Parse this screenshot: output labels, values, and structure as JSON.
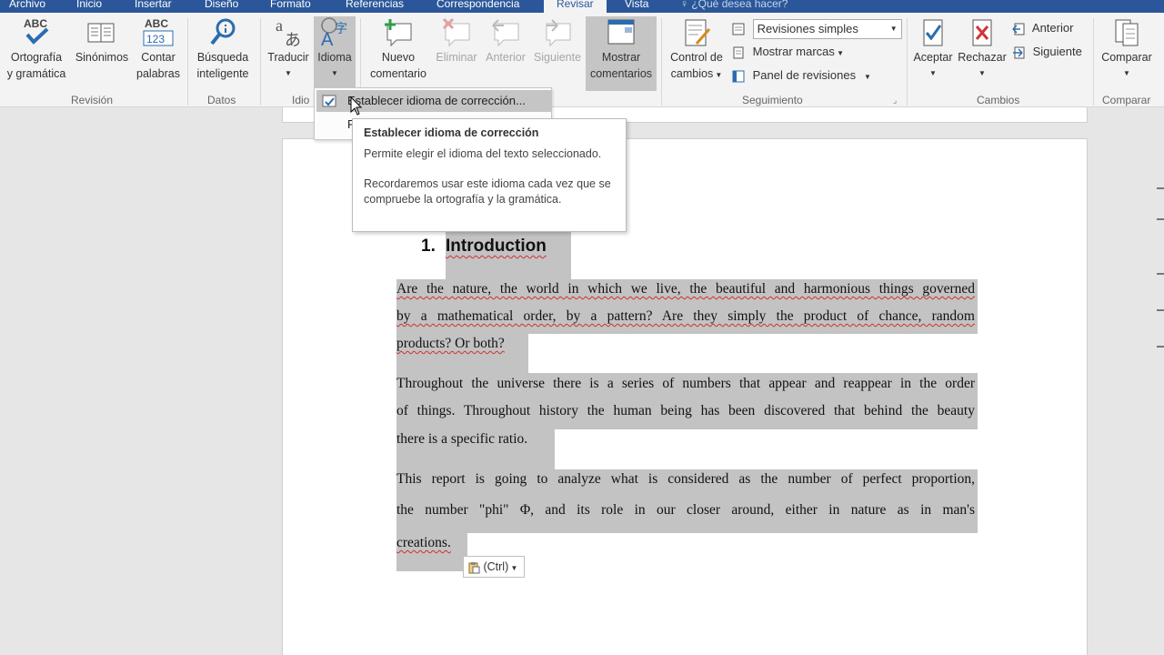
{
  "tabs": [
    "Archivo",
    "Inicio",
    "Insertar",
    "Diseño",
    "Formato",
    "Referencias",
    "Correspondencia",
    "Revisar",
    "Vista"
  ],
  "active_tab": "Revisar",
  "tell_me": "¿Qué desea hacer?",
  "ribbon": {
    "spelling": {
      "icon_text": "ABC",
      "line1": "Ortografía",
      "line2": "y gramática"
    },
    "thesaurus": {
      "line1": "Sinónimos"
    },
    "wordcount": {
      "icon_top": "ABC",
      "icon_bottom": "123",
      "line1": "Contar",
      "line2": "palabras"
    },
    "smart_lookup": {
      "line1": "Búsqueda",
      "line2": "inteligente"
    },
    "translate": {
      "line1": "Traducir"
    },
    "language": {
      "line1": "Idioma"
    },
    "new_comment": {
      "line1": "Nuevo",
      "line2": "comentario"
    },
    "delete": {
      "line1": "Eliminar"
    },
    "previous_comment": {
      "line1": "Anterior"
    },
    "next_comment": {
      "line1": "Siguiente"
    },
    "show_comments": {
      "line1": "Mostrar",
      "line2": "comentarios"
    },
    "track_changes": {
      "line1": "Control de",
      "line2": "cambios"
    },
    "markup_select": "Revisiones simples",
    "show_markup": "Mostrar marcas",
    "reviewing_pane": "Panel de revisiones",
    "accept": {
      "line1": "Aceptar"
    },
    "reject": {
      "line1": "Rechazar"
    },
    "previous_change": "Anterior",
    "next_change": "Siguiente",
    "compare": {
      "line1": "Comparar"
    },
    "groups": {
      "revision": "Revisión",
      "datos": "Datos",
      "idioma": "Idio",
      "seguimiento": "Seguimiento",
      "cambios": "Cambios",
      "comparar": "Comparar"
    }
  },
  "menu": {
    "item1": "Establecer idioma de corrección...",
    "item2_initial": "P"
  },
  "tooltip": {
    "title": "Establecer idioma de corrección",
    "body1": "Permite elegir el idioma del texto seleccionado.",
    "body2": "Recordaremos usar este idioma cada vez que se compruebe la ortografía y la gramática."
  },
  "document": {
    "heading_number": "1.",
    "heading_text": "Introduction",
    "p1": [
      "Are the nature, the world in which we live, the beautiful and harmonious things governed",
      "by a mathematical order, by a pattern? Are they simply the product of chance, random",
      "products? Or both?"
    ],
    "p2": [
      "Throughout the universe there is a series of numbers that appear and reappear in the order",
      "of things. Throughout history the human being has been discovered that behind the beauty",
      "there is a specific ratio."
    ],
    "p3": [
      "This report is going to analyze what is considered as the number of perfect proportion,",
      "the number \"phi\" Φ, and its role in our closer around, either in nature as in man's",
      "creations."
    ]
  },
  "paste_options": "(Ctrl)",
  "colors": {
    "tabbar": "#2b579a",
    "ribbon": "#f3f3f3",
    "selection": "#c3c3c3",
    "squiggle": "#d03030"
  }
}
